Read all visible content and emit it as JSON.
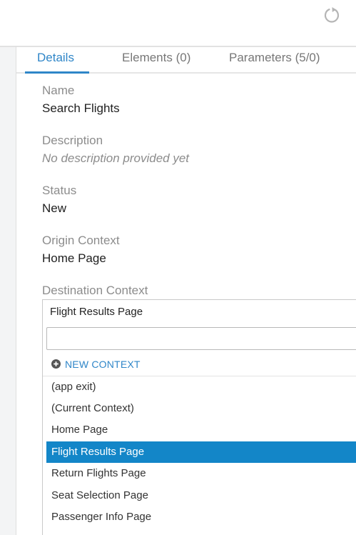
{
  "header": {
    "refresh_icon": "refresh-icon"
  },
  "tabs": [
    {
      "label": "Details",
      "active": true
    },
    {
      "label": "Elements (0)",
      "active": false
    },
    {
      "label": "Parameters (5/0)",
      "active": false
    }
  ],
  "fields": {
    "name": {
      "label": "Name",
      "value": "Search Flights"
    },
    "description": {
      "label": "Description",
      "value": "No description provided yet"
    },
    "status": {
      "label": "Status",
      "value": "New"
    },
    "origin_context": {
      "label": "Origin Context",
      "value": "Home Page"
    },
    "destination_context": {
      "label": "Destination Context",
      "selected": "Flight Results Page",
      "search_value": "",
      "new_context_label": "NEW CONTEXT",
      "options": [
        "(app exit)",
        "(Current Context)",
        "Home Page",
        "Flight Results Page",
        "Return Flights Page",
        "Seat Selection Page",
        "Passenger Info Page"
      ],
      "highlighted_index": 3
    }
  },
  "colors": {
    "accent": "#2f86c8",
    "highlight": "#1386c8",
    "label": "#8c8c8c"
  }
}
